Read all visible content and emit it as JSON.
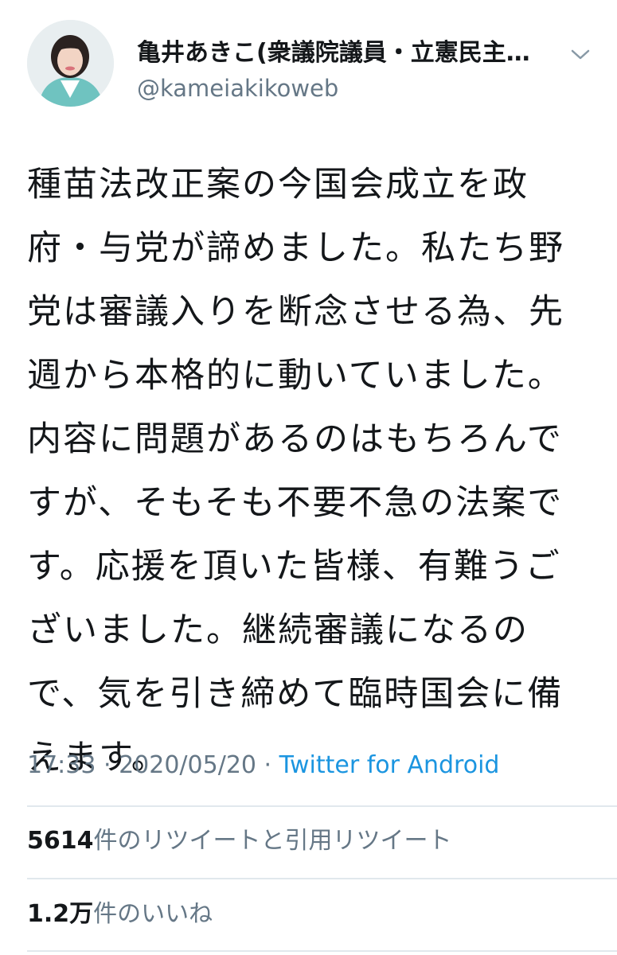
{
  "user": {
    "display_name": "亀井あきこ(衆議院議員・立憲民主…",
    "handle": "@kameiakikoweb",
    "avatar_icon": "profile-photo"
  },
  "menu_icon": "chevron-down-icon",
  "tweet": {
    "lines": [
      "種苗法改正案の今国会成立を政",
      "府・与党が諦めました。私たち野",
      "党は審議入りを断念させる為、先",
      "週から本格的に動いていました。",
      "内容に問題があるのはもちろんで",
      "すが、そもそも不要不急の法案で",
      "す。応援を頂いた皆様、有難うご",
      "ざいました。継続審議になるの",
      "で、気を引き締めて臨時国会に備",
      "えます。"
    ],
    "time": "17:33",
    "separator": " · ",
    "date": "2020/05/20",
    "source": "Twitter for Android"
  },
  "stats": {
    "retweets_count": "5614",
    "retweets_label": "件のリツイートと引用リツイート",
    "likes_count": "1.2万",
    "likes_label": "件のいいね"
  },
  "colors": {
    "text": "#14171a",
    "secondary": "#657786",
    "link": "#1b95e0",
    "divider": "#e1e8ed"
  }
}
